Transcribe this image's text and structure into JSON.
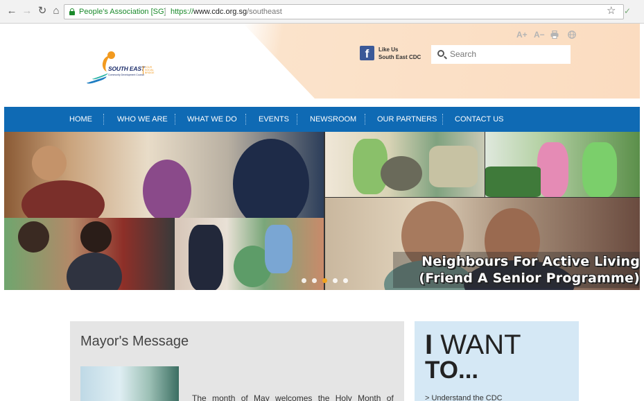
{
  "browser": {
    "site_name": "People's Association [SG]",
    "url_prefix": "https://",
    "url_main": "www.cdc.org.sg",
    "url_rest": "/southeast",
    "icons": [
      "back-icon",
      "forward-icon",
      "reload-icon",
      "home-icon",
      "lock-icon",
      "star-icon",
      "extension-icon"
    ]
  },
  "header": {
    "logo": {
      "name": "SOUTH EAST",
      "sub": "Community Development Council",
      "tag": [
        "YOUR",
        "SOCIAL",
        "BRIDGE"
      ]
    },
    "facebook": {
      "line1": "Like Us",
      "line2": "South East CDC"
    },
    "search_placeholder": "Search",
    "tools": {
      "font_up": "A+",
      "font_down": "A−"
    },
    "colors": {
      "accent": "#f29a1f",
      "nav_blue": "#0f6ab4",
      "peach": "#fbdcc0"
    }
  },
  "nav": [
    "HOME",
    "WHO WE ARE",
    "WHAT WE DO",
    "EVENTS",
    "NEWSROOM",
    "OUR PARTNERS",
    "CONTACT US"
  ],
  "hero": {
    "caption_line1": "Neighbours For Active Living",
    "caption_line2": "(Friend  A  Senior Programme)",
    "slides": 5,
    "active_slide": 3
  },
  "mayor": {
    "title": "Mayor's Message",
    "text": "The month of May welcomes the Holy Month of"
  },
  "iwant": {
    "line1_bold": "I",
    "line1_rest": " WANT",
    "line2": "TO...",
    "link": "> Understand the CDC"
  }
}
